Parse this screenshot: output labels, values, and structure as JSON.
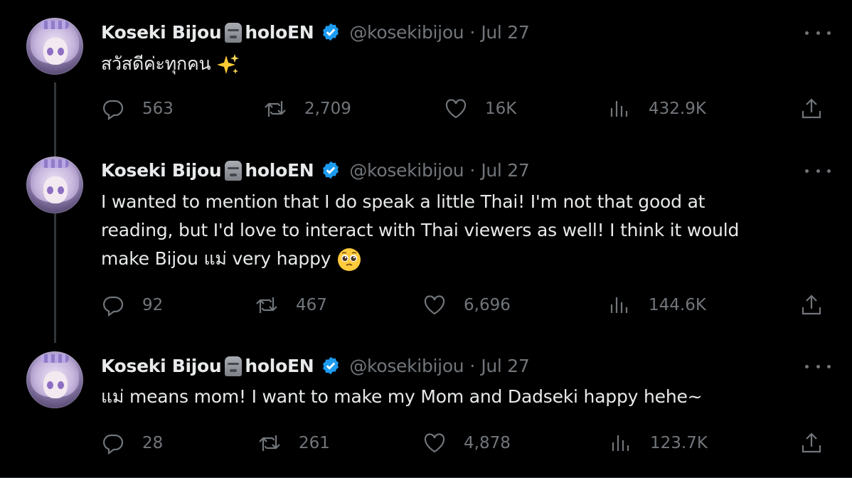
{
  "tweets": [
    {
      "author_name": "Koseki Bijou",
      "author_suffix": "holoEN",
      "handle": "@kosekibijou",
      "separator": "·",
      "date": "Jul 27",
      "text": "สวัสดีค่ะทุกคน",
      "replies": "563",
      "retweets": "2,709",
      "likes": "16K",
      "views": "432.9K"
    },
    {
      "author_name": "Koseki Bijou",
      "author_suffix": "holoEN",
      "handle": "@kosekibijou",
      "separator": "·",
      "date": "Jul 27",
      "text_lines": [
        "I wanted to mention that I do speak a little Thai! I'm not that good at",
        "reading, but I'd love to interact with Thai viewers as well! I think it would",
        "make Bijou แม่ very happy"
      ],
      "replies": "92",
      "retweets": "467",
      "likes": "6,696",
      "views": "144.6K"
    },
    {
      "author_name": "Koseki Bijou",
      "author_suffix": "holoEN",
      "handle": "@kosekibijou",
      "separator": "·",
      "date": "Jul 27",
      "text": "แม่ means mom! I want to make my Mom and Dadseki happy hehe~",
      "replies": "28",
      "retweets": "261",
      "likes": "4,878",
      "views": "123.7K"
    }
  ],
  "colors": {
    "background": "#000000",
    "text": "#e7e9ea",
    "muted": "#71767b",
    "verified": "#1d9bf0",
    "thread_line": "#333639"
  },
  "icons": [
    "sparkles-emoji",
    "pleading-face-emoji",
    "moai-emoji",
    "verified-badge-icon",
    "reply-icon",
    "retweet-icon",
    "like-icon",
    "views-icon",
    "share-icon",
    "more-icon"
  ]
}
